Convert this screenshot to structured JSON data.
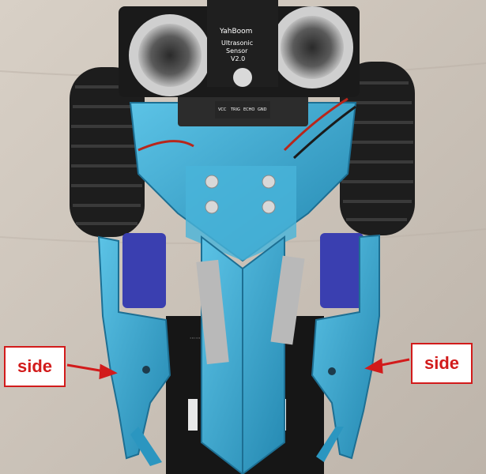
{
  "sensor": {
    "brand": "YahBoom",
    "name_line1": "Ultrasonic",
    "name_line2": "Sensor",
    "version": "V2.0",
    "pins": [
      "VCC",
      "TRIG",
      "ECHO",
      "GND"
    ]
  },
  "annotations": {
    "left_label": "side",
    "right_label": "side"
  },
  "colors": {
    "chassis_blue": "#3aa6cf",
    "label_red": "#d21b1b",
    "background": "#cfc7bd"
  }
}
